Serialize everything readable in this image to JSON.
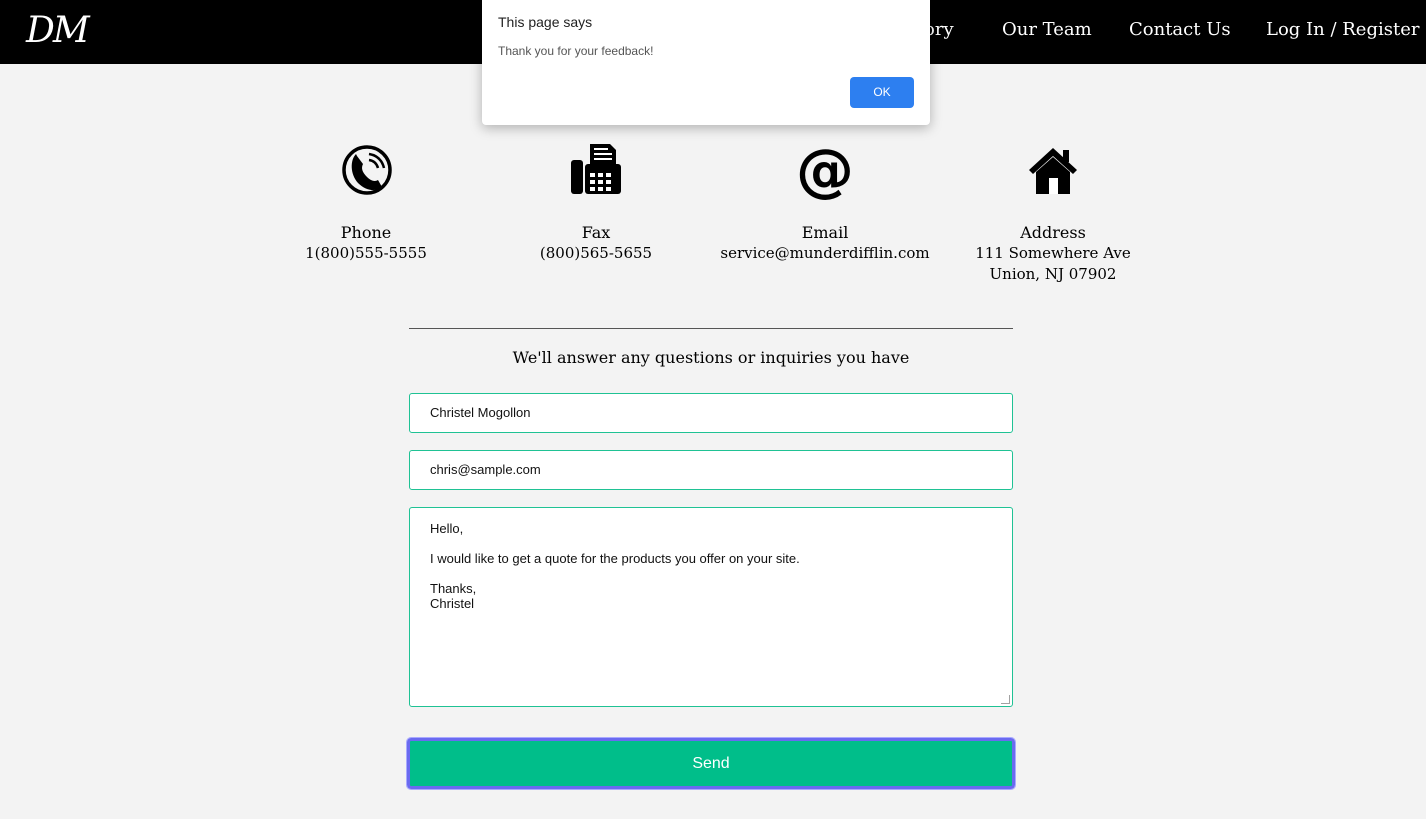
{
  "navbar": {
    "logo": "DM",
    "links": [
      "ory",
      "Our Team",
      "Contact Us",
      "Log In / Register"
    ]
  },
  "contact": [
    {
      "icon": "phone-icon",
      "title": "Phone",
      "lines": [
        "1(800)555-5555"
      ]
    },
    {
      "icon": "fax-icon",
      "title": "Fax",
      "lines": [
        "(800)565-5655"
      ]
    },
    {
      "icon": "at-sign-icon",
      "title": "Email",
      "lines": [
        "service@munderdifflin.com"
      ]
    },
    {
      "icon": "home-icon",
      "title": "Address",
      "lines": [
        "111 Somewhere Ave",
        "Union, NJ 07902"
      ]
    }
  ],
  "form": {
    "heading": "We'll answer any questions or inquiries you have",
    "name_value": "Christel Mogollon",
    "email_value": "chris@sample.com",
    "message_lines": [
      "Hello,",
      "",
      "I would like to get a quote for the products you offer on your site.",
      "",
      "Thanks,",
      "Christel"
    ],
    "send_label": "Send"
  },
  "dialog": {
    "title": "This page says",
    "message": "Thank you for your feedback!",
    "ok_label": "OK"
  },
  "colors": {
    "accent": "#00be8a",
    "field_border": "#1fc294",
    "dialog_button": "#2d7ff0"
  }
}
